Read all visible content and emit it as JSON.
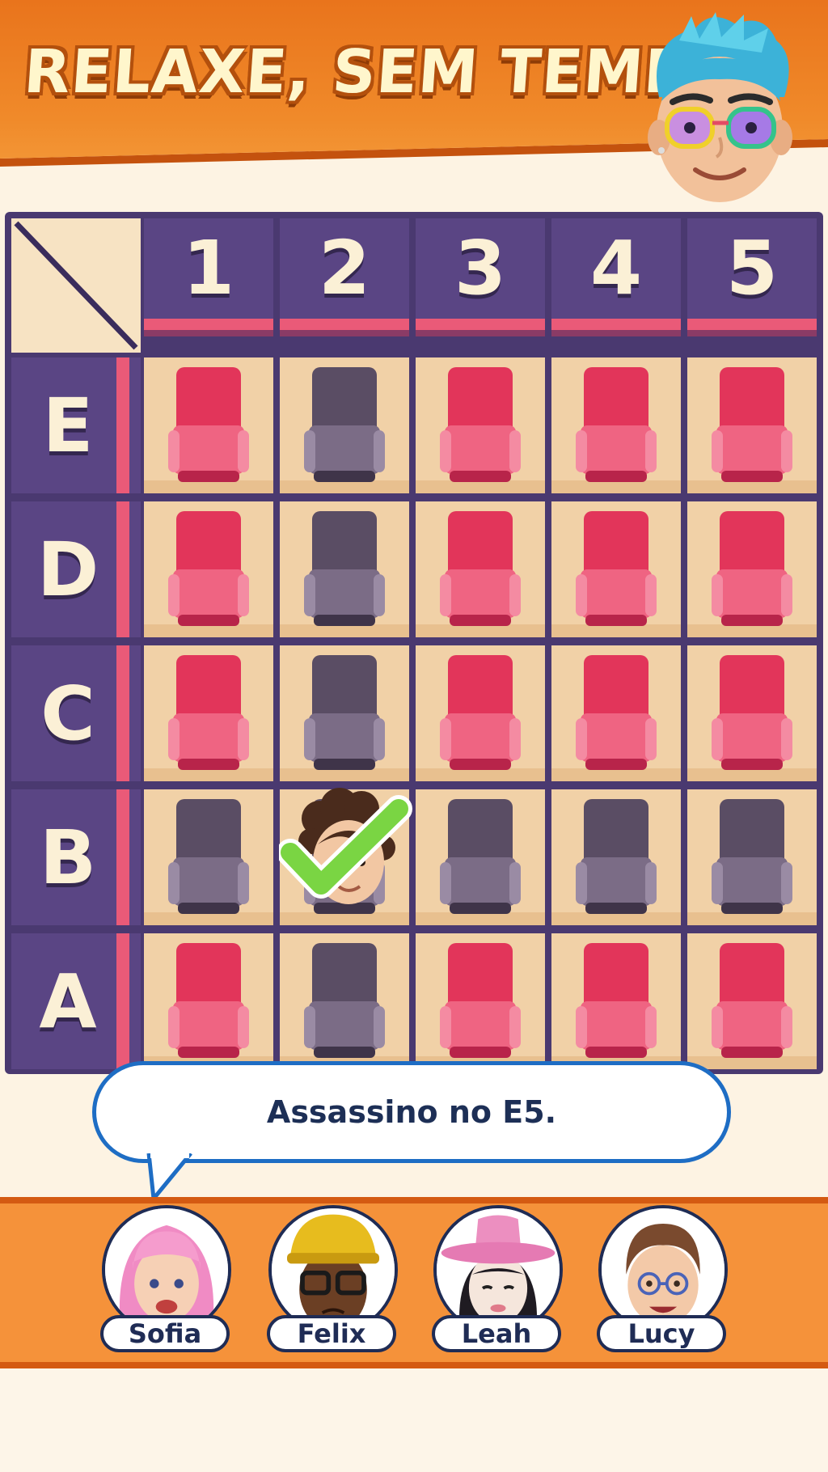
{
  "header": {
    "title": "RELAXE, SEM TEMPO!"
  },
  "board": {
    "columns": [
      "1",
      "2",
      "3",
      "4",
      "5"
    ],
    "rows": [
      "E",
      "D",
      "C",
      "B",
      "A"
    ],
    "seat_colors": {
      "red": "#e2355a",
      "gray": "#5a4d64"
    },
    "seats": {
      "E": [
        "red",
        "gray",
        "red",
        "red",
        "red"
      ],
      "D": [
        "red",
        "gray",
        "red",
        "red",
        "red"
      ],
      "C": [
        "red",
        "gray",
        "red",
        "red",
        "red"
      ],
      "B": [
        "gray",
        "occupied",
        "gray",
        "gray",
        "gray"
      ],
      "A": [
        "red",
        "gray",
        "red",
        "red",
        "red"
      ]
    }
  },
  "hint": {
    "text": "Assassino no E5."
  },
  "characters": [
    {
      "name": "Sofia"
    },
    {
      "name": "Felix"
    },
    {
      "name": "Leah"
    },
    {
      "name": "Lucy"
    }
  ]
}
